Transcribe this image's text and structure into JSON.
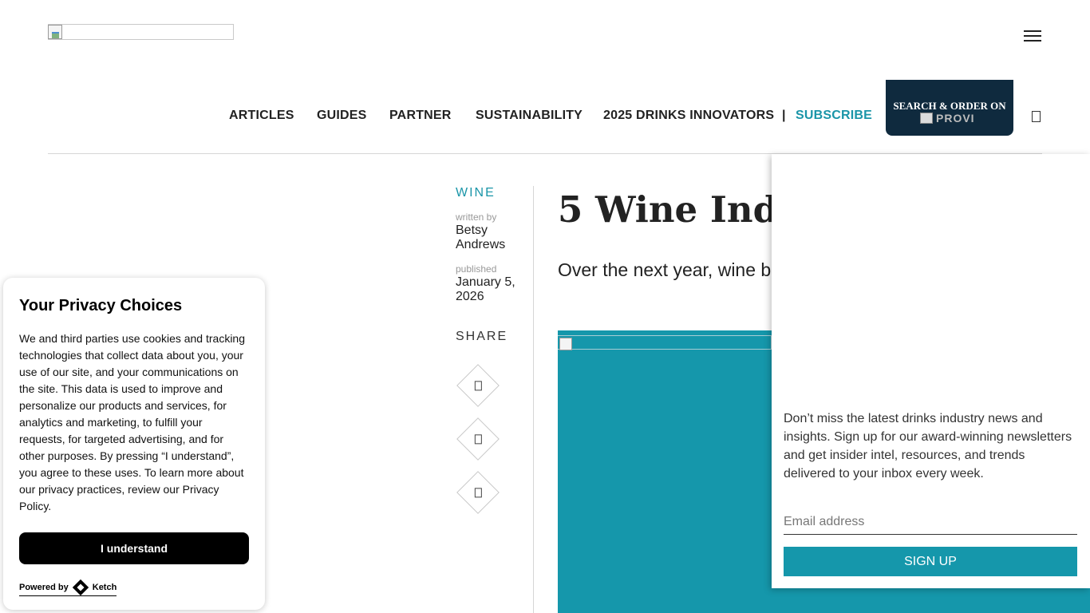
{
  "header": {
    "nav": [
      {
        "label": "ARTICLES"
      },
      {
        "label": "GUIDES"
      },
      {
        "label": "PARTNER"
      },
      {
        "label": "SUSTAINABILITY"
      },
      {
        "label": "2025 DRINKS INNOVATORS"
      }
    ],
    "separator": "|",
    "subscribe": "SUBSCRIBE",
    "provi": {
      "label": "SEARCH & ORDER ON",
      "img_alt": "PROVI"
    }
  },
  "article": {
    "category": "WINE",
    "written_by_label": "written by",
    "author": "Betsy Andrews",
    "published_label": "published",
    "date": "January 5, 2026",
    "share_label": "SHARE",
    "headline": "5 Wine Ind",
    "dek": "Over the next year, wine b"
  },
  "newsletter": {
    "copy": "Don’t miss the latest drinks industry news and insights. Sign up for our award-winning newsletters and get insider intel, resources, and trends delivered to your inbox every week.",
    "email_placeholder": "Email address",
    "button": "SIGN UP"
  },
  "privacy": {
    "title": "Your Privacy Choices",
    "body": "We and third parties use cookies and tracking technologies that collect data about you, your use of our site, and your communications on the site. This data is used to improve and personalize our products and services, for analytics and marketing, to fulfill your requests, for targeted advertising, and for other purposes. By pressing “I understand”, you agree to these uses. To learn more about our privacy practices, review our Privacy Policy.",
    "button": "I understand",
    "powered_by": "Powered by",
    "brand": "Ketch"
  },
  "colors": {
    "accent": "#1a95a8",
    "hero": "#1597ab",
    "provi_bg": "#0f2a3e"
  }
}
